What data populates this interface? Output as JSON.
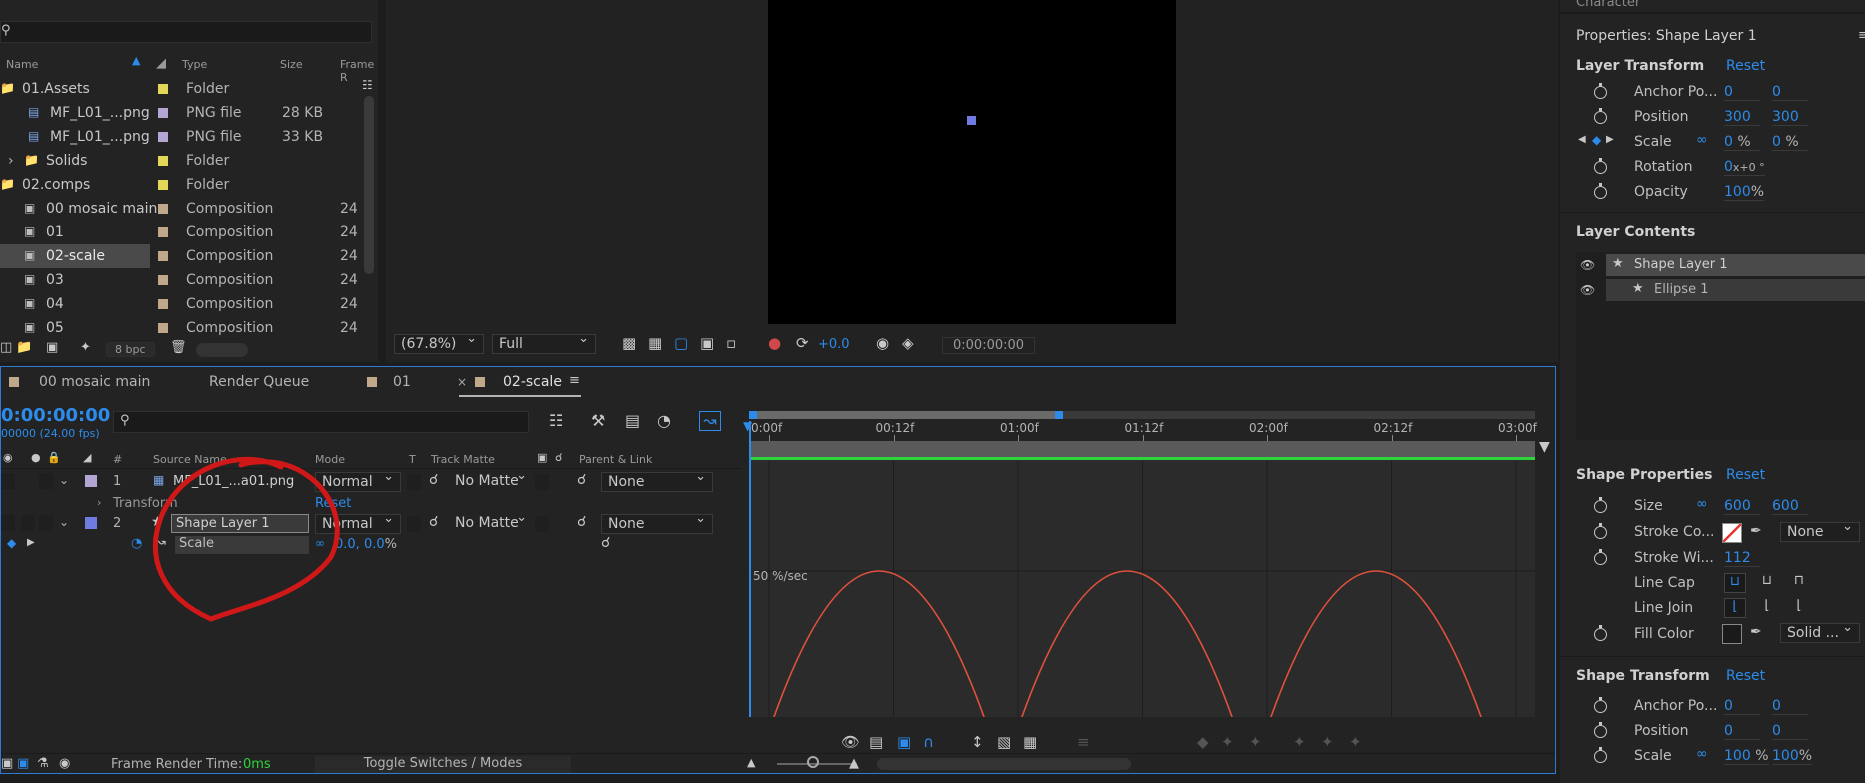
{
  "project": {
    "columns": {
      "name": "Name",
      "type": "Type",
      "size": "Size",
      "frame": "Frame R"
    },
    "rows": [
      {
        "name": "01.Assets",
        "type": "Folder",
        "size": "",
        "frame": "",
        "color": "#e3d75a",
        "kind": "folder"
      },
      {
        "name": "MF_L01_...png",
        "type": "PNG file",
        "size": "28 KB",
        "frame": "",
        "color": "#b3a6d3",
        "kind": "png"
      },
      {
        "name": "MF_L01_...png",
        "type": "PNG file",
        "size": "33 KB",
        "frame": "",
        "color": "#b3a6d3",
        "kind": "png"
      },
      {
        "name": "Solids",
        "type": "Folder",
        "size": "",
        "frame": "",
        "color": "#e3d75a",
        "kind": "folder"
      },
      {
        "name": "02.comps",
        "type": "Folder",
        "size": "",
        "frame": "",
        "color": "#e3d75a",
        "kind": "folder"
      },
      {
        "name": "00 mosaic main",
        "type": "Composition",
        "size": "",
        "frame": "24",
        "color": "#bfa98a",
        "kind": "comp"
      },
      {
        "name": "01",
        "type": "Composition",
        "size": "",
        "frame": "24",
        "color": "#bfa98a",
        "kind": "comp"
      },
      {
        "name": "02-scale",
        "type": "Composition",
        "size": "",
        "frame": "24",
        "color": "#bfa98a",
        "kind": "comp"
      },
      {
        "name": "03",
        "type": "Composition",
        "size": "",
        "frame": "24",
        "color": "#bfa98a",
        "kind": "comp"
      },
      {
        "name": "04",
        "type": "Composition",
        "size": "",
        "frame": "24",
        "color": "#bfa98a",
        "kind": "comp"
      },
      {
        "name": "05",
        "type": "Composition",
        "size": "",
        "frame": "24",
        "color": "#bfa98a",
        "kind": "comp"
      }
    ],
    "bpc": "8 bpc"
  },
  "viewer": {
    "zoom": "(67.8%)",
    "resolution": "Full",
    "exposure": "+0.0",
    "timecode": "0:00:00:00"
  },
  "timeline": {
    "tabs": [
      "00 mosaic main",
      "Render Queue",
      "01",
      "02-scale"
    ],
    "current_time": "0:00:00:00",
    "fps_text": "00000 (24.00 fps)",
    "col_source": "Source Name",
    "col_mode": "Mode",
    "col_t": "T",
    "col_matte": "Track Matte",
    "col_parent": "Parent & Link",
    "layers": [
      {
        "num": "1",
        "name": "MF_L01_...a01.png",
        "mode": "Normal",
        "matte": "No Matte",
        "parent": "None",
        "color": "#b3a6d3"
      },
      {
        "num": "2",
        "name": "Shape Layer 1",
        "mode": "Normal",
        "matte": "No Matte",
        "parent": "None",
        "color": "#6f7be0"
      }
    ],
    "transform_label": "Transform",
    "reset_label": "Reset",
    "scale_label": "Scale",
    "scale_value": "0.0, 0.0",
    "scale_unit": "%",
    "ruler": [
      "0:00f",
      "00:12f",
      "01:00f",
      "01:12f",
      "02:00f",
      "02:12f",
      "03:00f"
    ],
    "graph_label": "50 %/sec",
    "footer_render": "Frame Render Time:",
    "footer_render_value": "0ms",
    "footer_toggle": "Toggle Switches / Modes"
  },
  "properties": {
    "header_top": "Character",
    "title": "Properties: Shape Layer 1",
    "layer_transform": "Layer Transform",
    "reset": "Reset",
    "anchor_label": "Anchor Po...",
    "anchor_x": "0",
    "anchor_y": "0",
    "position_label": "Position",
    "position_x": "300",
    "position_y": "300",
    "scale_label": "Scale",
    "scale_x": "0",
    "scale_y": "0",
    "pct": "%",
    "rotation_label": "Rotation",
    "rotation_value": "0",
    "rotation_suffix": "x+0 °",
    "opacity_label": "Opacity",
    "opacity_value": "100",
    "layer_contents": "Layer Contents",
    "contents": [
      "Shape Layer 1",
      "Ellipse 1"
    ],
    "shape_properties": "Shape Properties",
    "size_label": "Size",
    "size_x": "600",
    "size_y": "600",
    "stroke_color_label": "Stroke Co...",
    "stroke_none": "None",
    "stroke_width_label": "Stroke Wi...",
    "stroke_width_value": "112",
    "line_cap_label": "Line Cap",
    "line_join_label": "Line Join",
    "fill_color_label": "Fill Color",
    "fill_solid": "Solid ...",
    "shape_transform": "Shape Transform",
    "st_anchor_x": "0",
    "st_anchor_y": "0",
    "st_position_x": "0",
    "st_position_y": "0",
    "st_scale_x": "100",
    "st_scale_y": "100"
  }
}
